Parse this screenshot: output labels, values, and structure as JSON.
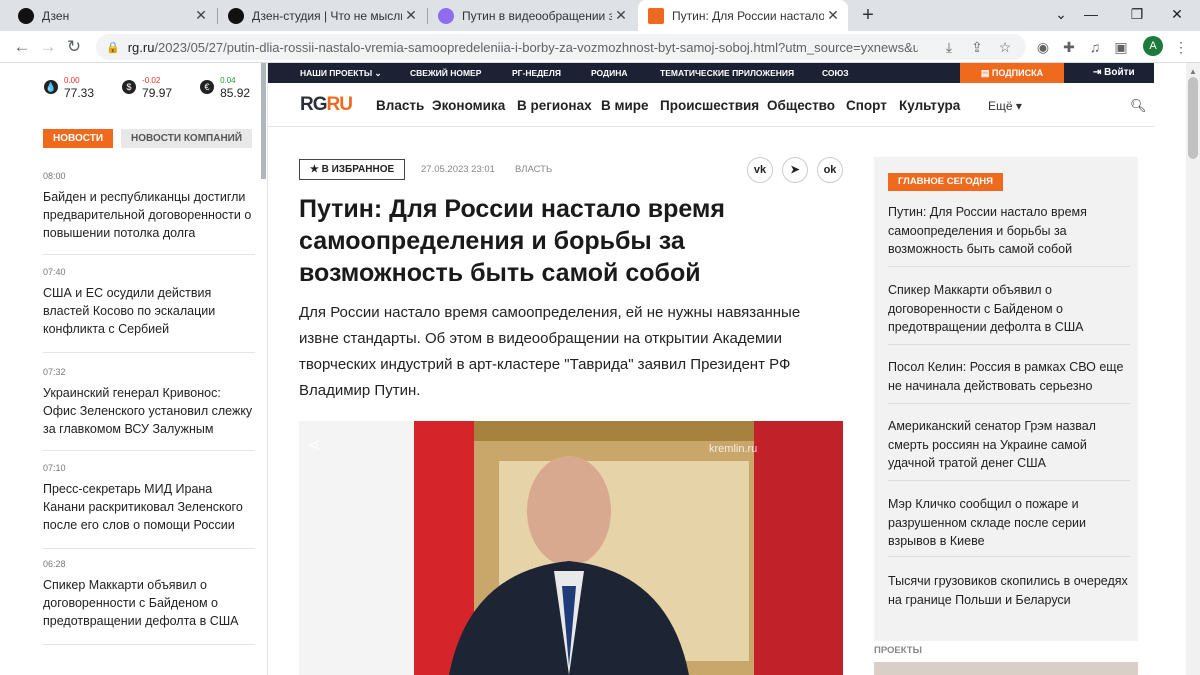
{
  "browser": {
    "tabs": [
      {
        "title": "Дзен"
      },
      {
        "title": "Дзен-студия | Что не мысль, то"
      },
      {
        "title": "Путин в видеообращении заяви"
      },
      {
        "title": "Путин: Для России настало вре"
      }
    ],
    "url_domain": "rg.ru",
    "url_path": "/2023/05/27/putin-dlia-rossii-nastalo-vremia-samoopredeleniia-i-borby-za-vozmozhnost-byt-samoj-soboj.html?utm_source=yxnews&utm_m...",
    "profile_initial": "A"
  },
  "rates": [
    {
      "symbol": "💧",
      "change": "0.00",
      "value": "77.33",
      "dir": "down"
    },
    {
      "symbol": "$",
      "change": "-0.02",
      "value": "79.97",
      "dir": "down"
    },
    {
      "symbol": "€",
      "change": "0.04",
      "value": "85.92",
      "dir": "up"
    }
  ],
  "left_tabs": {
    "news": "Новости",
    "company_news": "Новости компаний"
  },
  "news_feed": [
    {
      "time": "08:00",
      "headline": "Байден и республиканцы достигли предварительной договоренности о повышении потолка долга"
    },
    {
      "time": "07:40",
      "headline": "США и ЕС осудили действия властей Косово по эскалации конфликта с Сербией"
    },
    {
      "time": "07:32",
      "headline": "Украинский генерал Кривонос: Офис Зеленского установил слежку за главкомом ВСУ Залужным"
    },
    {
      "time": "07:10",
      "headline": "Пресс-секретарь МИД Ирана Канани раскритиковал Зеленского после его слов о помощи России"
    },
    {
      "time": "06:28",
      "headline": "Спикер Маккарти объявил о договоренности с Байденом о предотвращении дефолта в США"
    }
  ],
  "topstrip": {
    "projects": "Наши проекты",
    "fresh": "Свежий номер",
    "rg_week": "РГ-Неделя",
    "rodina": "Родина",
    "thematic": "Тематические приложения",
    "soyuz": "Союз",
    "subscribe": "ПОДПИСКА",
    "login": "Войти"
  },
  "logo": {
    "rg": "RG",
    "ru": "RU"
  },
  "nav": [
    "Власть",
    "Экономика",
    "В регионах",
    "В мире",
    "Происшествия",
    "Общество",
    "Спорт",
    "Культура"
  ],
  "nav_more": "Ещё",
  "article": {
    "favorite": "В ИЗБРАННОЕ",
    "date": "27.05.2023 23:01",
    "rubric": "ВЛАСТЬ",
    "share": [
      "vk",
      "telegram",
      "ok"
    ],
    "title": "Путин: Для России настало время самоопределения и борьбы за возможность быть самой собой",
    "lead": "Для России настало время самоопределения, ей не нужны навязанные извне стандарты. Об этом в видеообращении на открытии Академии творческих индустрий в арт-кластере \"Таврида\" заявил Президент РФ Владимир Путин.",
    "photo_watermark": "kremlin.ru"
  },
  "sidebar": {
    "badge": "Главное сегодня",
    "items": [
      "Путин: Для России настало время самоопределения и борьбы за возможность быть самой собой",
      "Спикер Маккарти объявил о договоренности с Байденом о предотвращении дефолта в США",
      "Посол Келин: Россия в рамках СВО еще не начинала действовать серьезно",
      "Американский сенатор Грэм назвал смерть россиян на Украине самой удачной тратой денег США",
      "Мэр Кличко сообщил о пожаре и разрушенном складе после серии взрывов в Киеве",
      "Тысячи грузовиков скопились в очередях на границе Польши и Беларуси"
    ],
    "projects_label": "Проекты"
  },
  "colors": {
    "accent": "#f06a1d",
    "dark": "#1c2233"
  }
}
